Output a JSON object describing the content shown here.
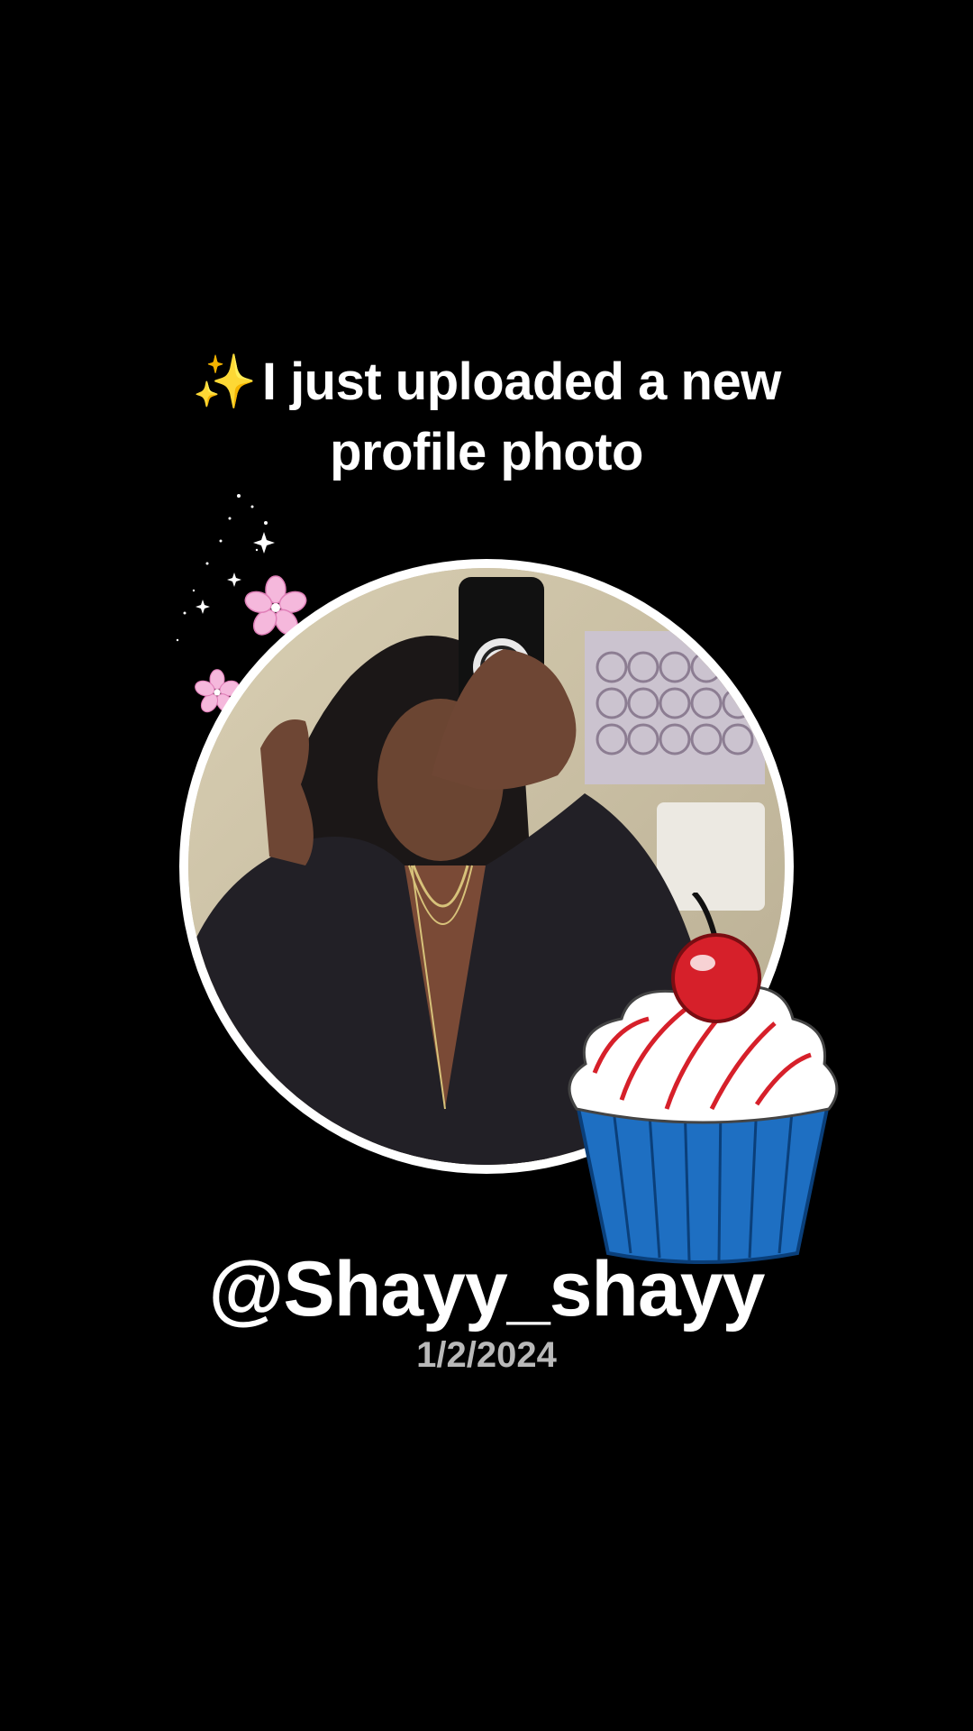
{
  "headline": {
    "sparkle": "✨",
    "line1": "I just uploaded a new",
    "line2": "profile photo"
  },
  "profile": {
    "username": "@Shayy_shayy",
    "date": "1/2/2024"
  },
  "decorations": {
    "icons": [
      "sparkles-icon",
      "pink-flower-icon",
      "cherry-cupcake-icon"
    ]
  },
  "colors": {
    "background": "#000000",
    "text": "#ffffff",
    "date_text": "#b9b9b9",
    "ring": "#ffffff"
  }
}
